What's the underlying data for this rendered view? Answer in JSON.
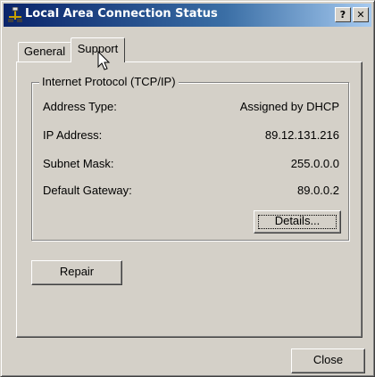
{
  "window": {
    "title": "Local Area Connection Status",
    "help_button": "?",
    "close_button": "✕"
  },
  "tabs": [
    {
      "label": "General",
      "selected": false
    },
    {
      "label": "Support",
      "selected": true
    }
  ],
  "support": {
    "group_title": "Internet Protocol (TCP/IP)",
    "rows": [
      {
        "label": "Address Type:",
        "value": "Assigned by DHCP"
      },
      {
        "label": "IP Address:",
        "value": "89.12.131.216"
      },
      {
        "label": "Subnet Mask:",
        "value": "255.0.0.0"
      },
      {
        "label": "Default Gateway:",
        "value": "89.0.0.2"
      }
    ],
    "details_button": "Details...",
    "repair_button": "Repair"
  },
  "footer": {
    "close_button": "Close"
  },
  "icons": {
    "title_icon": "network-connection-icon",
    "cursor": "mouse-pointer-icon"
  },
  "colors": {
    "titlebar_start": "#0a246a",
    "titlebar_end": "#a6caf0",
    "face": "#d4d0c8"
  }
}
